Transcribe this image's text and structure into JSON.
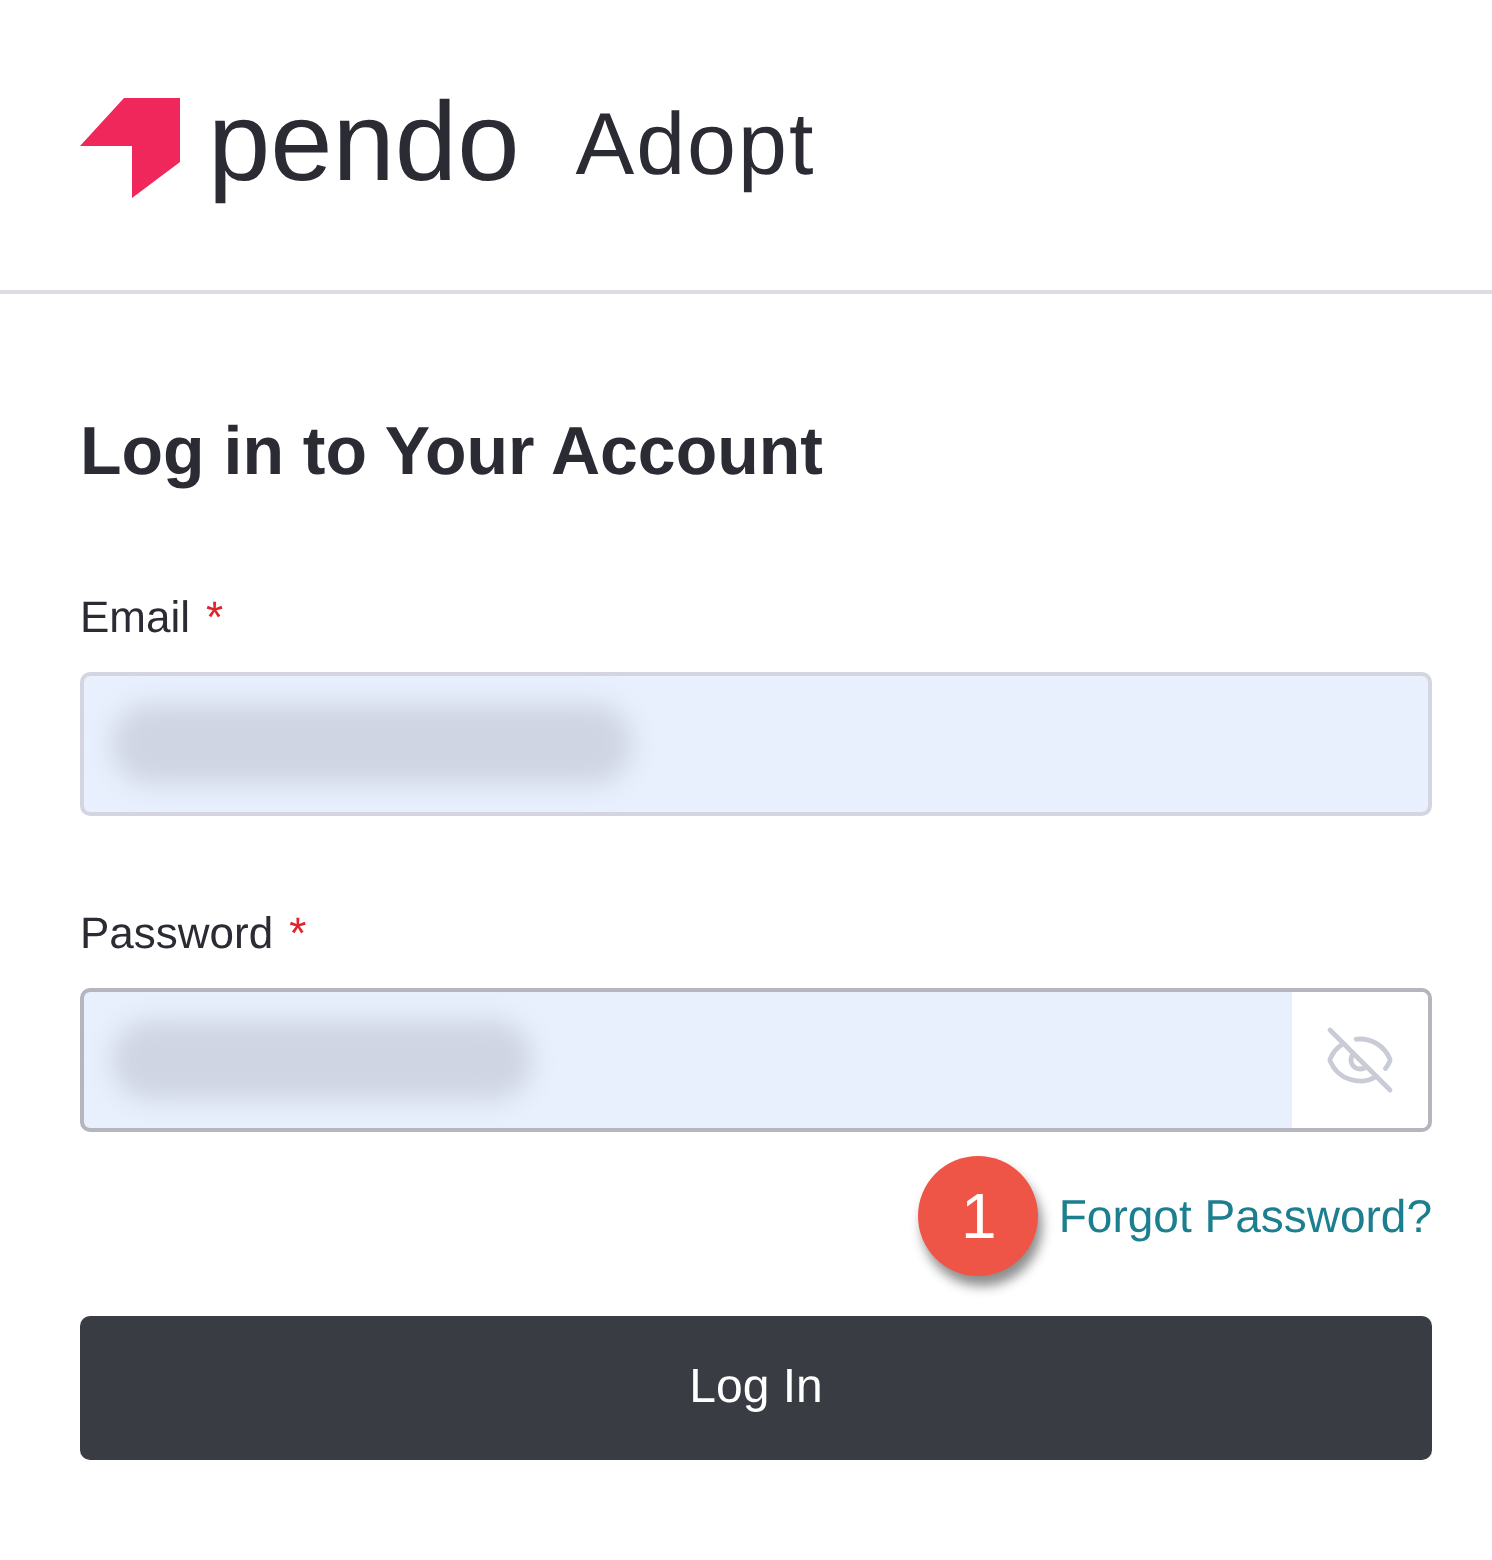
{
  "header": {
    "brand": "pendo",
    "product": "Adopt"
  },
  "form": {
    "title": "Log in to Your Account",
    "fields": [
      {
        "kind": "text",
        "label": "Email",
        "required_mark": "*"
      },
      {
        "kind": "password",
        "label": "Password",
        "required_mark": "*"
      }
    ],
    "callout": "1",
    "forgot_link": "Forgot Password?",
    "submit": "Log In"
  }
}
